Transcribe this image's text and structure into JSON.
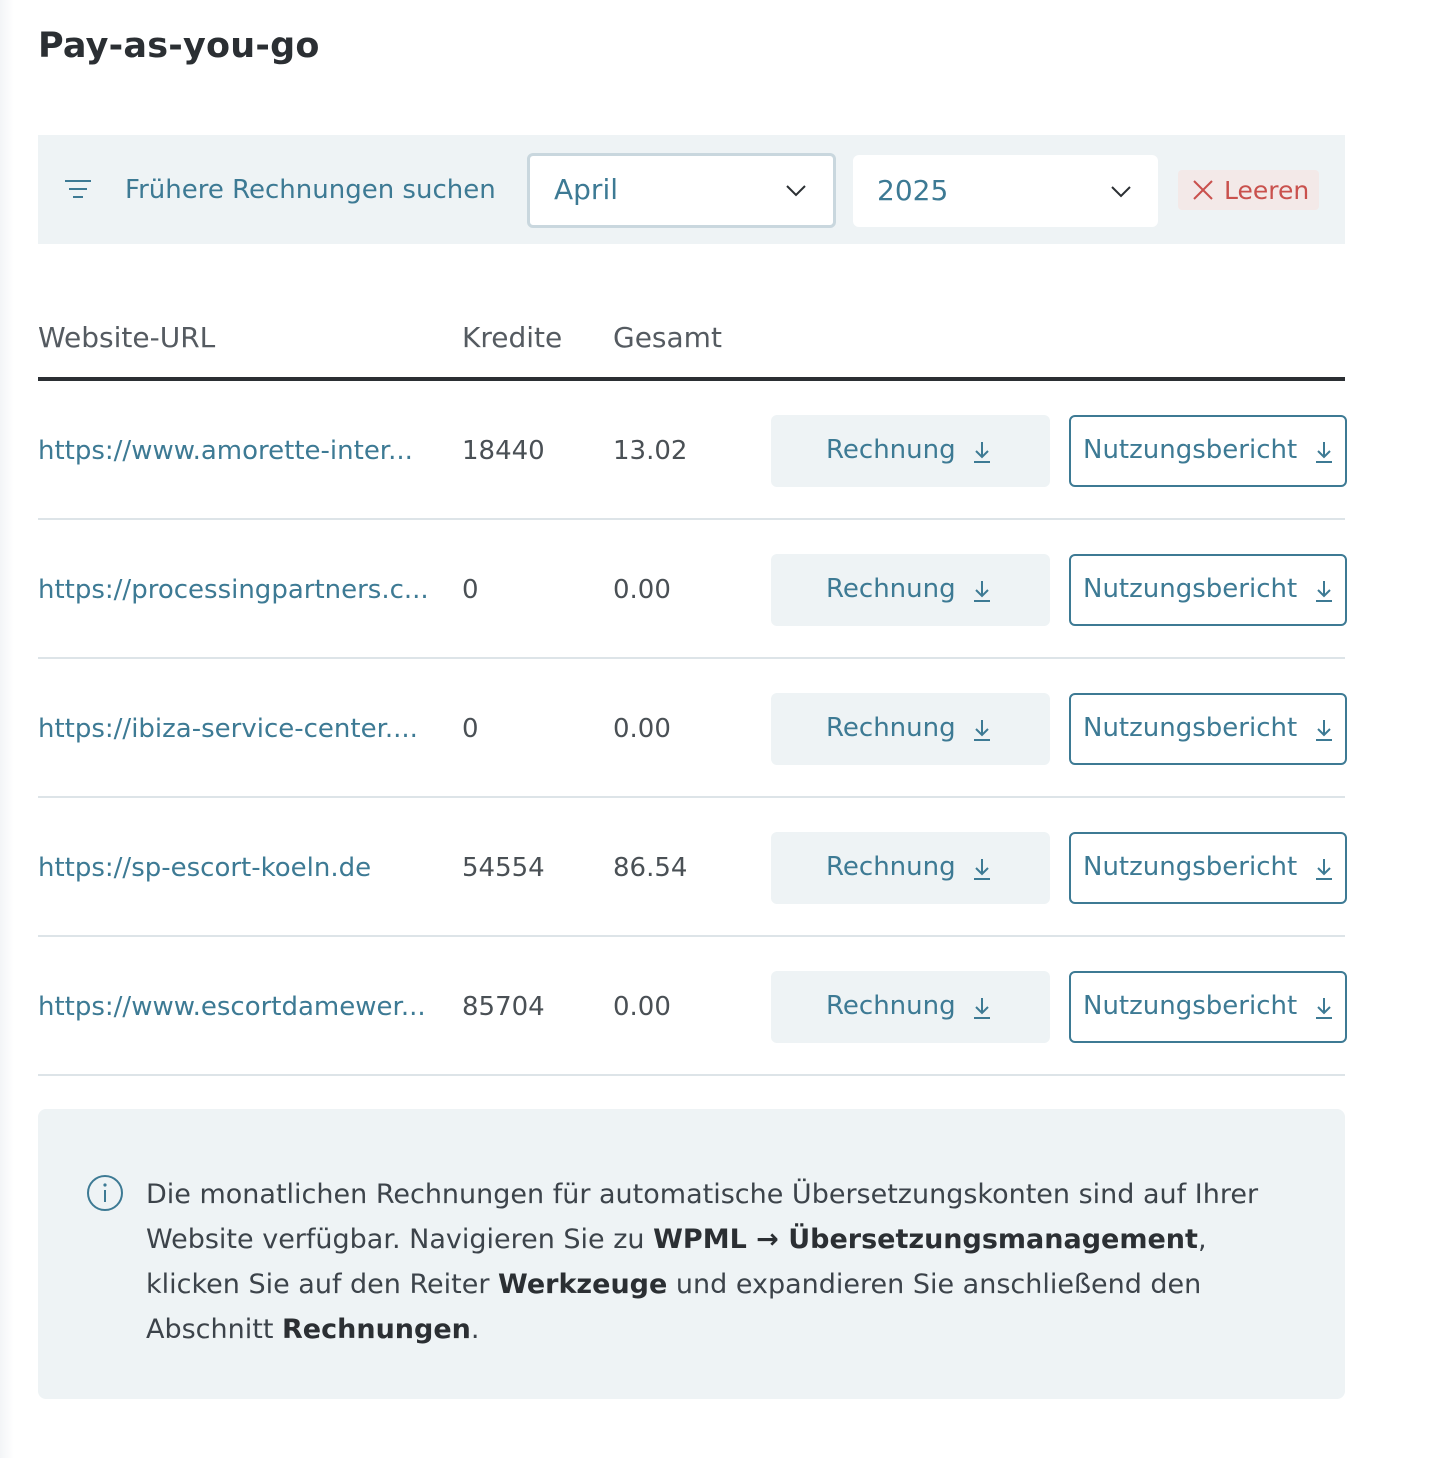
{
  "page": {
    "title": "Pay-as-you-go"
  },
  "filter": {
    "label": "Frühere Rechnungen suchen",
    "month": "April",
    "year": "2025",
    "clear_label": "Leeren"
  },
  "table": {
    "headers": {
      "url": "Website-URL",
      "credits": "Kredite",
      "total": "Gesamt"
    },
    "invoice_label": "Rechnung",
    "report_label": "Nutzungsbericht",
    "rows": [
      {
        "url": "https://www.amorette-inter...",
        "credits": "18440",
        "total": "13.02"
      },
      {
        "url": "https://processingpartners.c...",
        "credits": "0",
        "total": "0.00"
      },
      {
        "url": "https://ibiza-service-center....",
        "credits": "0",
        "total": "0.00"
      },
      {
        "url": "https://sp-escort-koeln.de",
        "credits": "54554",
        "total": "86.54"
      },
      {
        "url": "https://www.escortdamewer...",
        "credits": "85704",
        "total": "0.00"
      }
    ]
  },
  "info": {
    "t1": "Die monatlichen Rechnungen für automatische Übersetzungskonten sind auf Ihrer Website verfügbar. Navigieren Sie zu ",
    "b1": "WPML → Übersetzungsmanagement",
    "t2": ", klicken Sie auf den Reiter ",
    "b2": "Werkzeuge",
    "t3": " und expandieren Sie anschließend den Abschnitt ",
    "b3": "Rechnungen",
    "t4": "."
  },
  "colors": {
    "accent": "#3d7a94",
    "danger": "#c9514d",
    "panel": "#eef3f5"
  }
}
